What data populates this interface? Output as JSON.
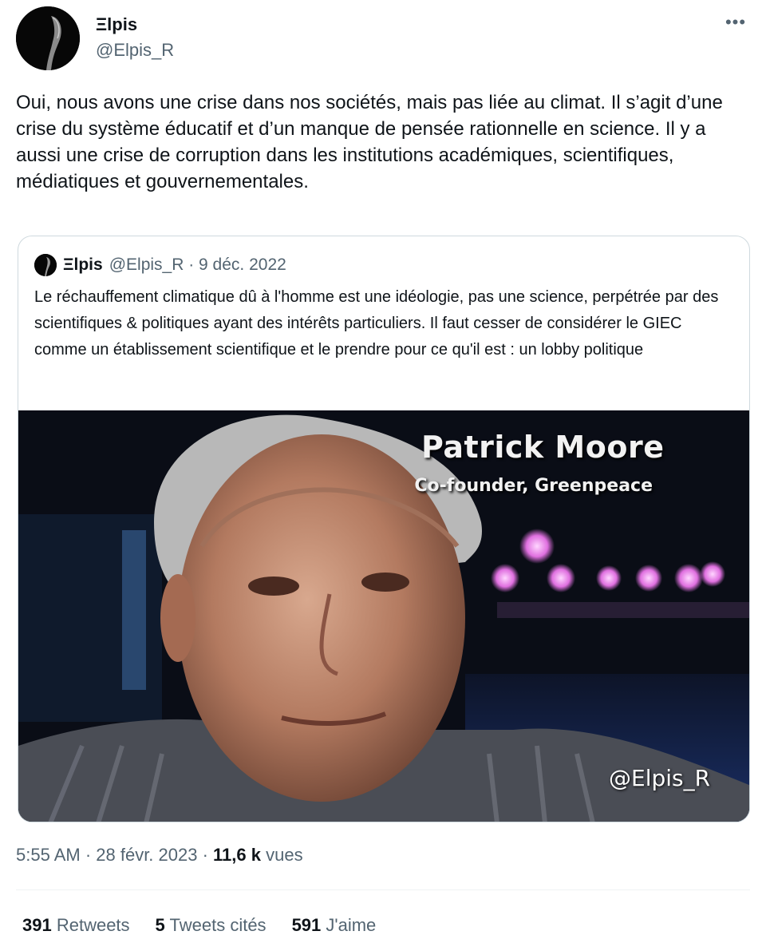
{
  "author": {
    "display_name": "Ξlpis",
    "handle": "@Elpis_R"
  },
  "more_icon": "more-horizontal-icon",
  "tweet": {
    "text": "Oui, nous avons une crise dans nos sociétés, mais pas liée au climat. Il s’agit d’une crise du système éducatif et d’un manque de pensée rationnelle en science. Il y a aussi une crise de corruption dans les institutions académiques, scientifiques, médiatiques et gouvernementales."
  },
  "quoted_tweet": {
    "display_name": "Ξlpis",
    "meta": "@Elpis_R · 9 déc. 2022",
    "text": "Le réchauffement climatique dû à l'homme est une idéologie, pas une science, perpétrée par des scientifiques & politiques ayant des intérêts particuliers. Il faut cesser de considérer le GIEC comme un établissement scientifique et le prendre pour ce qu'il est : un lobby politique",
    "media": {
      "caption_name": "Patrick Moore",
      "caption_role": "Co-founder, Greenpeace",
      "watermark": "@Elpis_R"
    }
  },
  "timestamp": {
    "time_date": "5:55 AM · 28 févr. 2023 · ",
    "views_count": "11,6 k",
    "views_label": " vues"
  },
  "stats": {
    "retweets_count": "391",
    "retweets_label": " Retweets",
    "quotes_count": "5",
    "quotes_label": " Tweets cités",
    "likes_count": "591",
    "likes_label": " J'aime"
  },
  "colors": {
    "text_primary": "#0f1419",
    "text_secondary": "#536471",
    "border": "#cfd9de"
  }
}
